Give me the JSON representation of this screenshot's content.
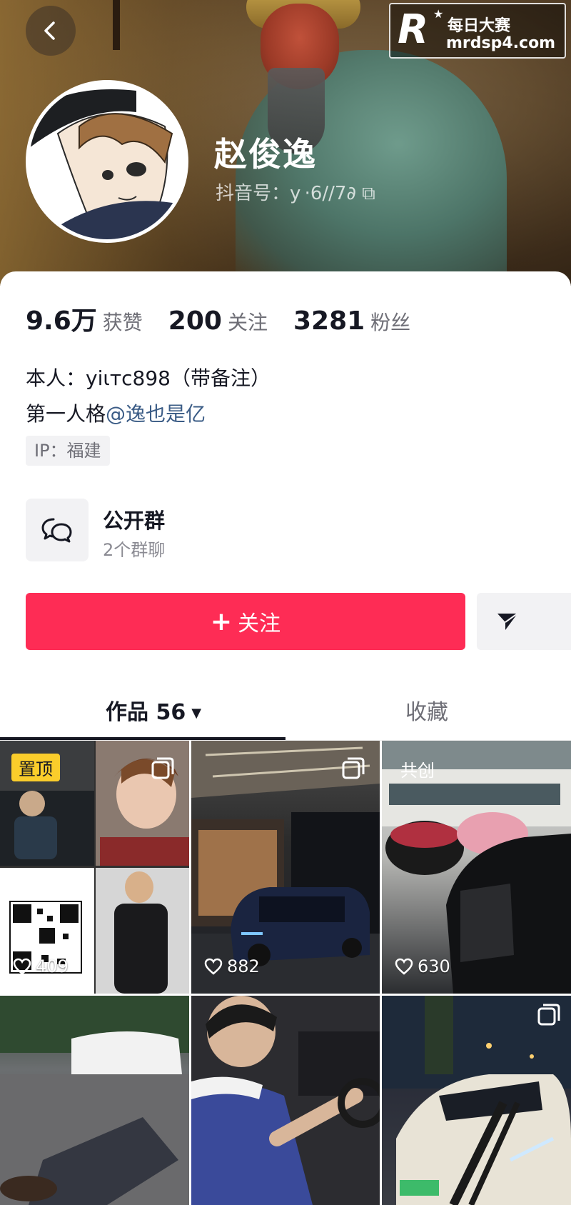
{
  "header": {
    "username": "赵俊逸",
    "douyin_id": "抖音号：y ·6∕∕7∂ ⧉",
    "watermark": {
      "logo_letter": "R",
      "title": "每日大赛",
      "url": "mrdsp4.com"
    }
  },
  "stats": [
    {
      "value": "9.6万",
      "label": "获赞"
    },
    {
      "value": "200",
      "label": "关注"
    },
    {
      "value": "3281",
      "label": "粉丝"
    }
  ],
  "bio": {
    "line1": "本人：yiιᴛᴄ898（带备注）",
    "line2_prefix": "第一人格",
    "line2_mention": "@逸也是亿",
    "ip": "IP：福建"
  },
  "group": {
    "title": "公开群",
    "subtitle": "2个群聊"
  },
  "actions": {
    "follow_plus": "+",
    "follow_label": "关注"
  },
  "tabs": [
    {
      "label": "作品 56",
      "active": true
    },
    {
      "label": "收藏",
      "active": false
    }
  ],
  "grid": {
    "pinned_label": "置顶",
    "co_create_label": "共创",
    "cells": [
      {
        "likes": "409"
      },
      {
        "likes": "882"
      },
      {
        "likes": "630"
      },
      {
        "likes": ""
      },
      {
        "likes": ""
      },
      {
        "likes": ""
      }
    ]
  },
  "colors": {
    "accent": "#fe2c55",
    "pin_badge": "#facd2b",
    "mention": "#3b5c86"
  },
  "icons": [
    "back-icon",
    "chat-bubbles-icon",
    "send-icon",
    "caret-down-icon",
    "multi-image-icon",
    "heart-icon"
  ]
}
